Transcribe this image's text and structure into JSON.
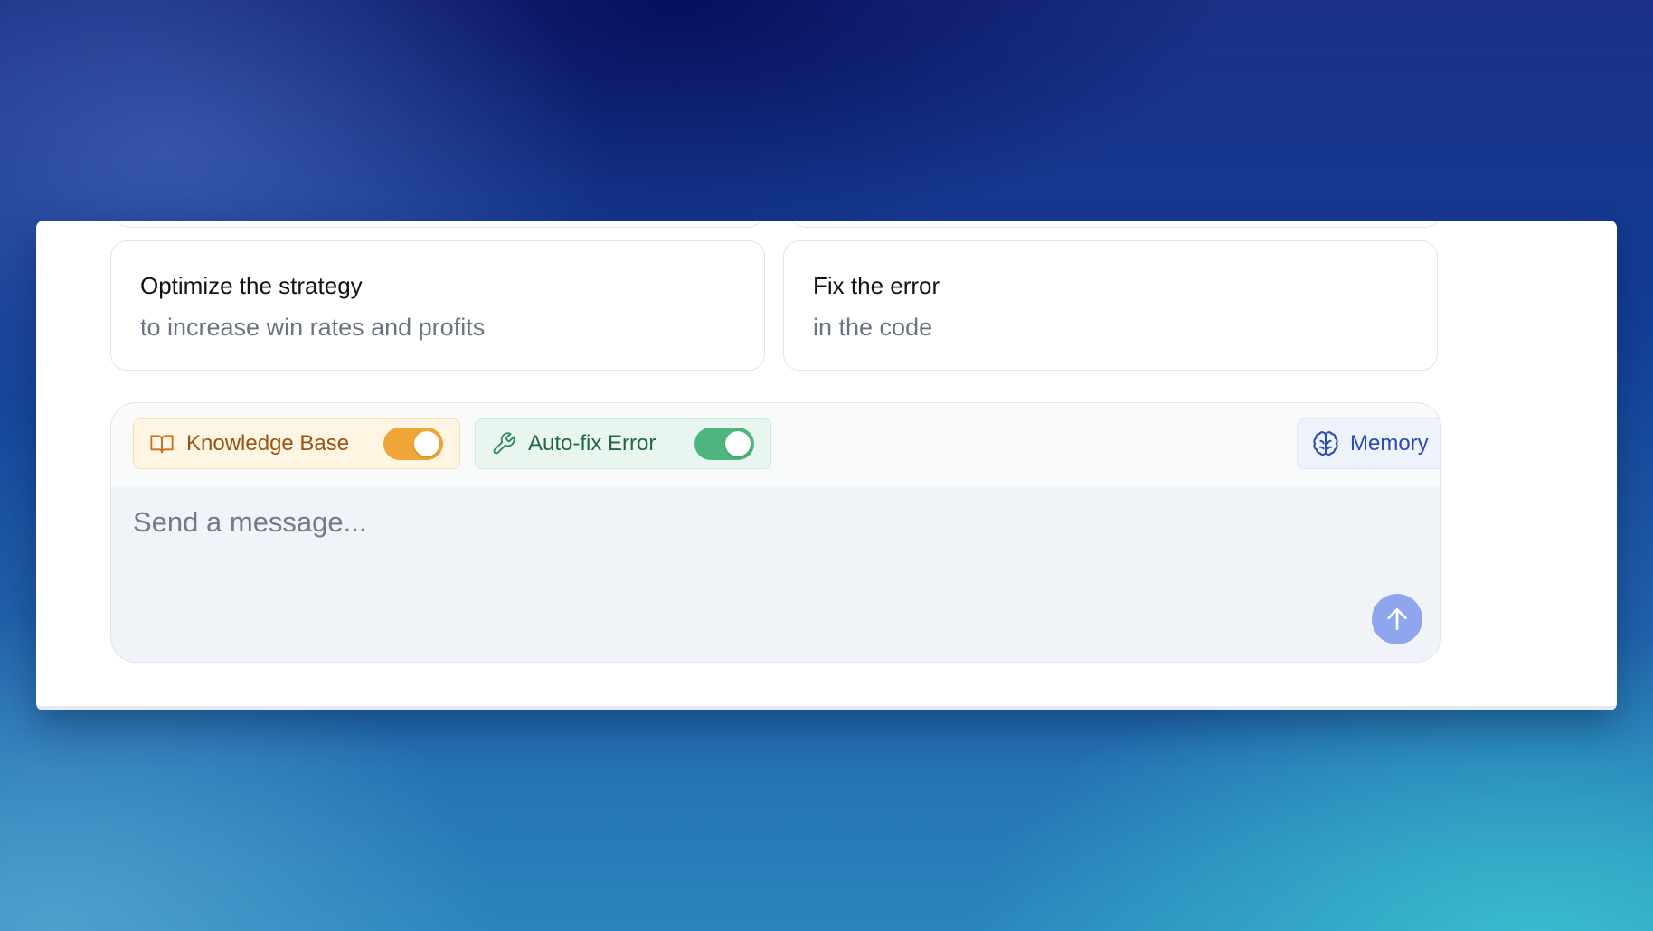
{
  "suggestions": [
    {
      "title": "Optimize the strategy",
      "subtitle": "to increase win rates and profits"
    },
    {
      "title": "Fix the error",
      "subtitle": "in the code"
    }
  ],
  "composer": {
    "knowledge_base": {
      "label": "Knowledge Base",
      "icon": "book-open-icon",
      "enabled": true,
      "color": "#eea636"
    },
    "auto_fix": {
      "label": "Auto-fix Error",
      "icon": "wrench-icon",
      "enabled": true,
      "color": "#4eb57e"
    },
    "memory": {
      "label": "Memory",
      "icon": "brain-icon",
      "color": "#2b49b8"
    },
    "input": {
      "placeholder": "Send a message...",
      "value": ""
    },
    "send": {
      "icon": "arrow-up-icon",
      "color": "#8fa6ee"
    }
  }
}
